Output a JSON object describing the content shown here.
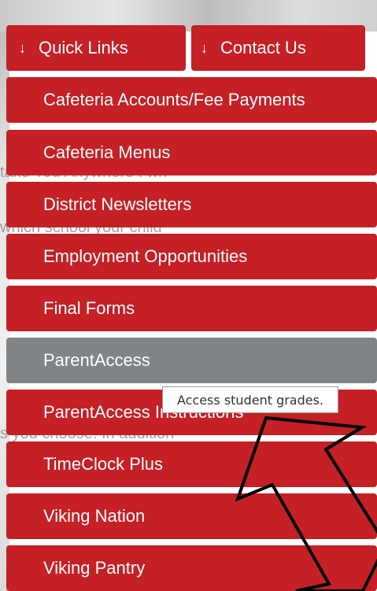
{
  "quick_links": {
    "label": "Quick Links",
    "arrow": "↓"
  },
  "contact_us": {
    "label": "Contact Us",
    "arrow": "↓"
  },
  "menu": [
    {
      "label": "Cafeteria Accounts/Fee Payments"
    },
    {
      "label": "Cafeteria Menus"
    },
    {
      "label": "District Newsletters"
    },
    {
      "label": "Employment Opportunities"
    },
    {
      "label": "Final Forms"
    },
    {
      "label": "ParentAccess"
    },
    {
      "label": "ParentAccess Instructions"
    },
    {
      "label": "TimeClock Plus"
    },
    {
      "label": "Viking Nation"
    },
    {
      "label": "Viking Pantry"
    }
  ],
  "tooltip": {
    "text": "Access student grades."
  },
  "colors": {
    "brand_red": "#c42026",
    "active_gray": "#808487"
  }
}
